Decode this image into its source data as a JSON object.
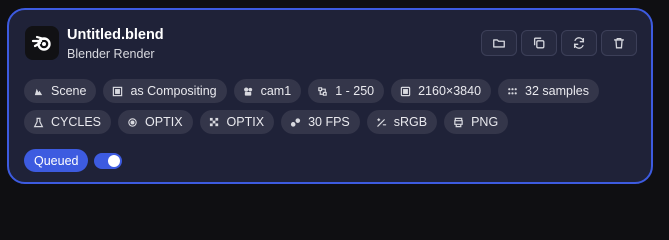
{
  "card": {
    "title": "Untitled.blend",
    "subtitle": "Blender Render"
  },
  "actions": [
    {
      "icon": "folder-icon"
    },
    {
      "icon": "copy-icon"
    },
    {
      "icon": "refresh-icon"
    },
    {
      "icon": "trash-icon"
    }
  ],
  "tags_row1": [
    {
      "icon": "scene-icon",
      "label": "Scene"
    },
    {
      "icon": "layer-icon",
      "label": "as Compositing"
    },
    {
      "icon": "camera-icon",
      "label": "cam1"
    },
    {
      "icon": "frames-icon",
      "label": "1 - 250"
    },
    {
      "icon": "resolution-icon",
      "label": "2160×3840"
    },
    {
      "icon": "samples-icon",
      "label": "32 samples"
    }
  ],
  "tags_row2": [
    {
      "icon": "engine-icon",
      "label": "CYCLES"
    },
    {
      "icon": "chip-icon",
      "label": "OPTIX"
    },
    {
      "icon": "denoise-icon",
      "label": "OPTIX"
    },
    {
      "icon": "fps-icon",
      "label": "30 FPS"
    },
    {
      "icon": "colorspace-icon",
      "label": "sRGB"
    },
    {
      "icon": "format-icon",
      "label": "PNG"
    }
  ],
  "status": {
    "label": "Queued",
    "toggle_on": true
  },
  "colors": {
    "accent": "#3d5be0",
    "card_bg": "#1f2238",
    "chip_bg": "#34364a"
  }
}
